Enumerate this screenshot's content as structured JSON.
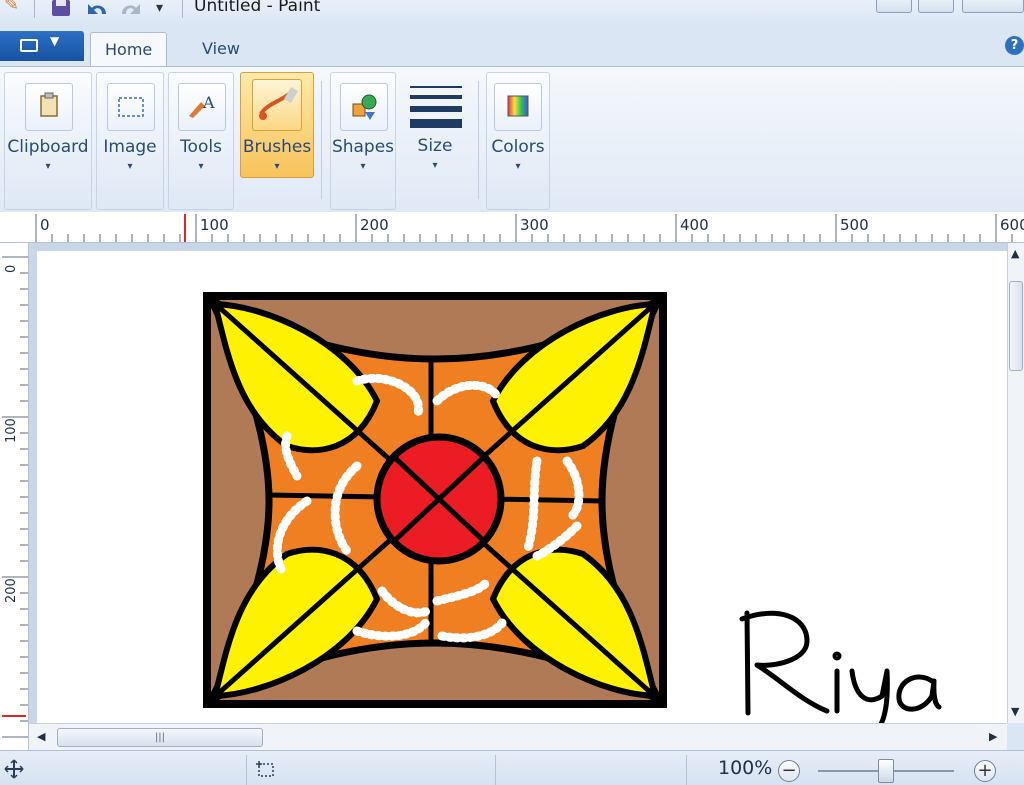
{
  "window": {
    "title": "Untitled - Paint",
    "qat_more": "▾"
  },
  "tabs": [
    {
      "label": "Home"
    },
    {
      "label": "View"
    }
  ],
  "help_label": "?",
  "ribbon": {
    "groups": [
      {
        "label": "Clipboard",
        "icon": "clipboard-icon",
        "caret": "▾"
      },
      {
        "label": "Image",
        "icon": "select-icon",
        "caret": "▾"
      },
      {
        "label": "Tools",
        "icon": "tools-icon",
        "caret": "▾"
      },
      {
        "label": "Brushes",
        "icon": "brush-icon",
        "caret": "▾",
        "active": true
      },
      {
        "label": "Shapes",
        "icon": "shapes-icon",
        "caret": "▾"
      },
      {
        "label": "Size",
        "icon": "size-icon",
        "caret": "▾"
      },
      {
        "label": "Colors",
        "icon": "colors-icon",
        "caret": "▾"
      }
    ]
  },
  "ruler": {
    "horizontal": [
      "0",
      "100",
      "200",
      "300",
      "400",
      "500",
      "600"
    ],
    "vertical": [
      "0",
      "100",
      "200"
    ]
  },
  "canvas": {
    "signature": "Riya"
  },
  "scrollbar": {
    "grip": "|||"
  },
  "status": {
    "zoom": "100%",
    "zoom_out": "−",
    "zoom_in": "+",
    "zoom_fraction": 0.5
  },
  "colors": {
    "tile_brown": "#b07a56",
    "tile_orange": "#f07f22",
    "petal_yellow": "#fff200",
    "center_red": "#ec1c24",
    "stroke": "#000000",
    "dots_white": "#ffffff"
  }
}
